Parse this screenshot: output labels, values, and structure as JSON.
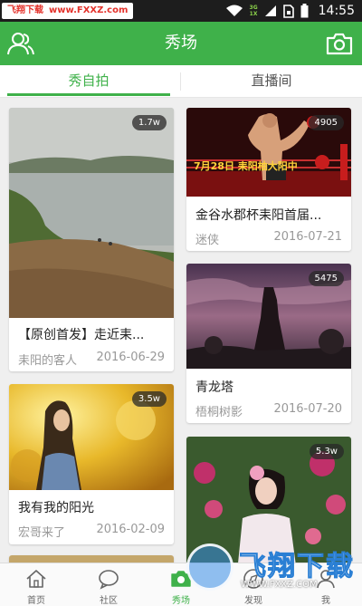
{
  "status_bar": {
    "watermark_name": "飞翔下载",
    "watermark_url": "www.FXXZ.com",
    "network_top": "3G",
    "network_bottom": "1X",
    "time": "14:55"
  },
  "header": {
    "title": "秀场",
    "left_icon": "users-icon",
    "right_icon": "camera-icon"
  },
  "tabs": [
    {
      "label": "秀自拍",
      "active": true
    },
    {
      "label": "直播间",
      "active": false
    }
  ],
  "feed": {
    "left": [
      {
        "count": "1.7w",
        "title": "【原创首发】走近耒...",
        "author": "耒阳的客人",
        "date": "2016-06-29"
      },
      {
        "count": "3.5w",
        "title": "我有我的阳光",
        "author": "宏哥来了",
        "date": "2016-02-09"
      }
    ],
    "right": [
      {
        "count": "4905",
        "title": "金谷水郡杯耒阳首届...",
        "author": "迷侠",
        "date": "2016-07-21",
        "poster_text": "7月28日 耒阳柚大阳中"
      },
      {
        "count": "5475",
        "title": "青龙塔",
        "author": "梧桐树影",
        "date": "2016-07-20"
      },
      {
        "count": "5.3w"
      }
    ]
  },
  "bottom_nav": [
    {
      "label": "首页",
      "icon": "home-icon",
      "active": false
    },
    {
      "label": "社区",
      "icon": "chat-bubble-icon",
      "active": false
    },
    {
      "label": "秀场",
      "icon": "camera-icon",
      "active": true
    },
    {
      "label": "发现",
      "icon": "discover-icon",
      "active": false
    },
    {
      "label": "我",
      "icon": "user-icon",
      "active": false
    }
  ],
  "watermark_bottom": {
    "text": "飞翔下载",
    "url": "WWW.FXXZ.COM"
  },
  "colors": {
    "primary_green": "#3fb14a",
    "status_bar": "#1d1d1d",
    "background": "#efefef"
  }
}
